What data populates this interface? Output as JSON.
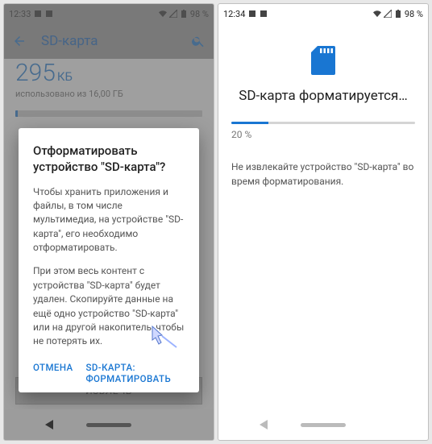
{
  "left": {
    "status": {
      "time": "12:33",
      "battery": "98 %"
    },
    "header": {
      "title": "SD-карта"
    },
    "storage": {
      "value": "295",
      "unit": "КБ",
      "sub": "использовано из 16,00 ГБ"
    },
    "eject": "ИЗВЛЕЧЬ",
    "dialog": {
      "title": "Отформатировать устройство \"SD-карта\"?",
      "p1": "Чтобы хранить приложения и файлы, в том числе мультимедиа, на устройстве \"SD-карта\", его необходимо отформатировать.",
      "p2": "При этом весь контент с устройства \"SD-карта\" будет удален. Скопируйте данные на ещё одно устройство \"SD-карта\" или на другой накопитель, чтобы не потерять их.",
      "cancel": "ОТМЕНА",
      "confirm": "SD-КАРТА: ФОРМАТИРОВАТЬ"
    }
  },
  "right": {
    "status": {
      "time": "12:34",
      "battery": "98 %"
    },
    "title": "SD-карта форматируется…",
    "progress_label": "20 %",
    "progress_pct": 20,
    "warn": "Не извлекайте устройство \"SD-карта\" во время форматирования."
  },
  "colors": {
    "accent": "#1976d2"
  }
}
